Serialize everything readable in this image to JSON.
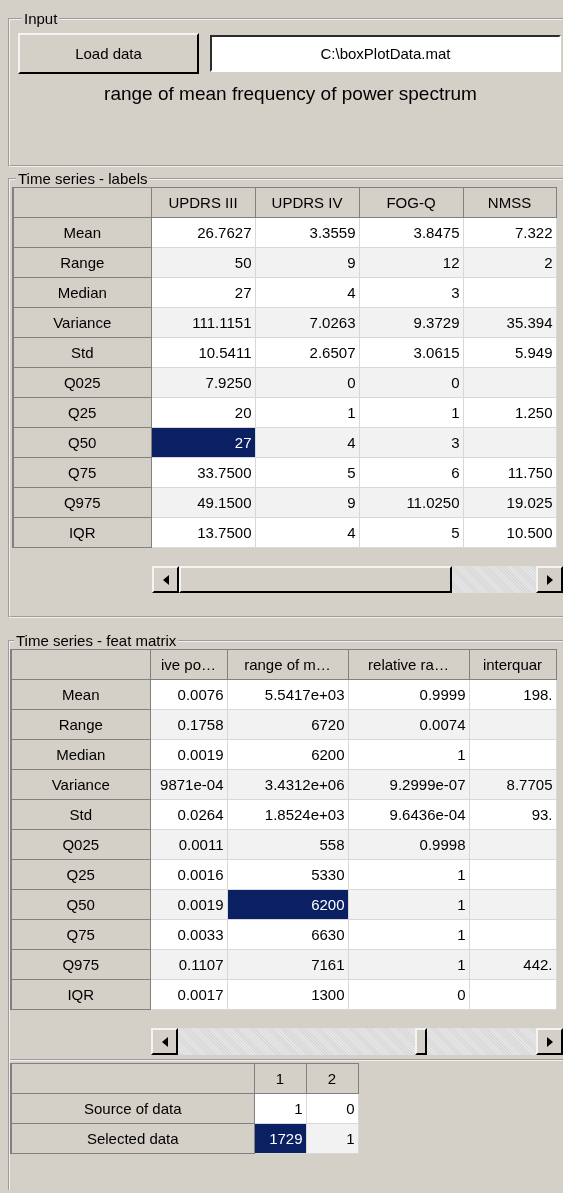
{
  "input": {
    "title": "Input",
    "load_button": "Load data",
    "file_field": {
      "value": "C:\\boxPlotData.mat"
    },
    "caption": "range of mean frequency of power spectrum"
  },
  "labels_table": {
    "title": "Time series - labels",
    "columns": [
      "UPDRS III",
      "UPDRS IV",
      "FOG-Q",
      "NMSS"
    ],
    "rows": [
      {
        "label": "Mean",
        "cells": [
          {
            "v": "26.7627",
            "selected": false
          },
          {
            "v": "3.3559",
            "selected": false
          },
          {
            "v": "3.8475",
            "selected": false
          },
          {
            "v": "7.322",
            "selected": false
          }
        ]
      },
      {
        "label": "Range",
        "cells": [
          {
            "v": "50",
            "selected": false
          },
          {
            "v": "9",
            "selected": false
          },
          {
            "v": "12",
            "selected": false
          },
          {
            "v": "2",
            "selected": false
          }
        ]
      },
      {
        "label": "Median",
        "cells": [
          {
            "v": "27",
            "selected": false
          },
          {
            "v": "4",
            "selected": false
          },
          {
            "v": "3",
            "selected": false
          },
          {
            "selected": false
          }
        ]
      },
      {
        "label": "Variance",
        "cells": [
          {
            "v": "111.1151",
            "selected": false
          },
          {
            "v": "7.0263",
            "selected": false
          },
          {
            "v": "9.3729",
            "selected": false
          },
          {
            "v": "35.394",
            "selected": false
          }
        ]
      },
      {
        "label": "Std",
        "cells": [
          {
            "v": "10.5411",
            "selected": false
          },
          {
            "v": "2.6507",
            "selected": false
          },
          {
            "v": "3.0615",
            "selected": false
          },
          {
            "v": "5.949",
            "selected": false
          }
        ]
      },
      {
        "label": "Q025",
        "cells": [
          {
            "v": "7.9250",
            "selected": false
          },
          {
            "v": "0",
            "selected": false
          },
          {
            "v": "0",
            "selected": false
          },
          {
            "selected": false
          }
        ]
      },
      {
        "label": "Q25",
        "cells": [
          {
            "v": "20",
            "selected": false
          },
          {
            "v": "1",
            "selected": false
          },
          {
            "v": "1",
            "selected": false
          },
          {
            "v": "1.250",
            "selected": false
          }
        ]
      },
      {
        "label": "Q50",
        "cells": [
          {
            "v": "27",
            "selected": true
          },
          {
            "v": "4",
            "selected": false
          },
          {
            "v": "3",
            "selected": false
          },
          {
            "selected": false
          }
        ]
      },
      {
        "label": "Q75",
        "cells": [
          {
            "v": "33.7500",
            "selected": false
          },
          {
            "v": "5",
            "selected": false
          },
          {
            "v": "6",
            "selected": false
          },
          {
            "v": "11.750",
            "selected": false
          }
        ]
      },
      {
        "label": "Q975",
        "cells": [
          {
            "v": "49.1500",
            "selected": false
          },
          {
            "v": "9",
            "selected": false
          },
          {
            "v": "11.0250",
            "selected": false
          },
          {
            "v": "19.025",
            "selected": false
          }
        ]
      },
      {
        "label": "IQR",
        "cells": [
          {
            "v": "13.7500",
            "selected": false
          },
          {
            "v": "4",
            "selected": false
          },
          {
            "v": "5",
            "selected": false
          },
          {
            "v": "10.500",
            "selected": false
          }
        ]
      }
    ]
  },
  "feat_table": {
    "title": "Time series - feat matrix",
    "columns": [
      "ive po…",
      "range of m…",
      "relative ra…",
      "interquar"
    ],
    "rows": [
      {
        "label": "Mean",
        "cells": [
          {
            "v": "0.0076",
            "selected": false
          },
          {
            "v": "5.5417e+03",
            "selected": false
          },
          {
            "v": "0.9999",
            "selected": false
          },
          {
            "v": "198.",
            "selected": false
          }
        ]
      },
      {
        "label": "Range",
        "cells": [
          {
            "v": "0.1758",
            "selected": false
          },
          {
            "v": "6720",
            "selected": false
          },
          {
            "v": "0.0074",
            "selected": false
          },
          {
            "selected": false
          }
        ]
      },
      {
        "label": "Median",
        "cells": [
          {
            "v": "0.0019",
            "selected": false
          },
          {
            "v": "6200",
            "selected": false
          },
          {
            "v": "1",
            "selected": false
          },
          {
            "selected": false
          }
        ]
      },
      {
        "label": "Variance",
        "cells": [
          {
            "v": "9871e-04",
            "selected": false
          },
          {
            "v": "3.4312e+06",
            "selected": false
          },
          {
            "v": "9.2999e-07",
            "selected": false
          },
          {
            "v": "8.7705",
            "selected": false
          }
        ]
      },
      {
        "label": "Std",
        "cells": [
          {
            "v": "0.0264",
            "selected": false
          },
          {
            "v": "1.8524e+03",
            "selected": false
          },
          {
            "v": "9.6436e-04",
            "selected": false
          },
          {
            "v": "93.",
            "selected": false
          }
        ]
      },
      {
        "label": "Q025",
        "cells": [
          {
            "v": "0.0011",
            "selected": false
          },
          {
            "v": "558",
            "selected": false
          },
          {
            "v": "0.9998",
            "selected": false
          },
          {
            "selected": false
          }
        ]
      },
      {
        "label": "Q25",
        "cells": [
          {
            "v": "0.0016",
            "selected": false
          },
          {
            "v": "5330",
            "selected": false
          },
          {
            "v": "1",
            "selected": false
          },
          {
            "selected": false
          }
        ]
      },
      {
        "label": "Q50",
        "cells": [
          {
            "v": "0.0019",
            "selected": false
          },
          {
            "v": "6200",
            "selected": true
          },
          {
            "v": "1",
            "selected": false
          },
          {
            "selected": false
          }
        ]
      },
      {
        "label": "Q75",
        "cells": [
          {
            "v": "0.0033",
            "selected": false
          },
          {
            "v": "6630",
            "selected": false
          },
          {
            "v": "1",
            "selected": false
          },
          {
            "selected": false
          }
        ]
      },
      {
        "label": "Q975",
        "cells": [
          {
            "v": "0.1107",
            "selected": false
          },
          {
            "v": "7161",
            "selected": false
          },
          {
            "v": "1",
            "selected": false
          },
          {
            "v": "442.",
            "selected": false
          }
        ]
      },
      {
        "label": "IQR",
        "cells": [
          {
            "v": "0.0017",
            "selected": false
          },
          {
            "v": "1300",
            "selected": false
          },
          {
            "v": "0",
            "selected": false
          },
          {
            "selected": false
          }
        ]
      }
    ]
  },
  "selection_table": {
    "columns": [
      "1",
      "2"
    ],
    "rows": [
      {
        "label": "Source of data",
        "cells": [
          {
            "v": "1",
            "selected": false
          },
          {
            "v": "0",
            "selected": false
          }
        ]
      },
      {
        "label": "Selected data",
        "cells": [
          {
            "v": "1729",
            "selected": true
          },
          {
            "v": "1",
            "selected": false
          }
        ]
      }
    ]
  }
}
